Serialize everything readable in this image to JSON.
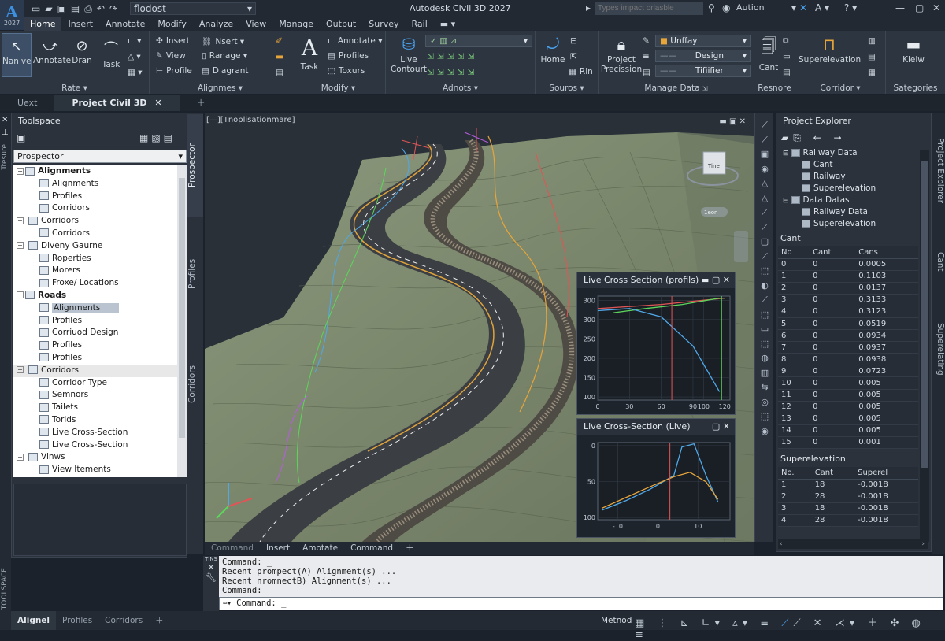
{
  "app": {
    "logo_letter": "A",
    "year": "2027",
    "title": "Autodesk Civil 3D 2027",
    "document": "flodost",
    "search_placeholder": "Types impact orlasble",
    "user": "Aution"
  },
  "menu_tabs": [
    "Home",
    "Insert",
    "Annotate",
    "Modify",
    "Analyze",
    "View",
    "Manage",
    "Output",
    "Survey",
    "Rail"
  ],
  "ribbon": {
    "home_btns": [
      "Nanive",
      "Annotate",
      "Dran",
      "Task"
    ],
    "p1_title": "Rate",
    "p2_rows": [
      "Insert",
      "View",
      "Profile"
    ],
    "p2_rows_b": [
      "Nsert",
      "Ranage",
      "Diagrant"
    ],
    "p2_title": "Alignmes",
    "p3_btn": "Task",
    "p3_rows": [
      "Annotate",
      "Profiles",
      "Toxurs"
    ],
    "p3_title": "Modify",
    "p4_btn": "Live Contourt",
    "p4_title": "Adnots",
    "p5_btn": "Home",
    "p5_row": "Rin",
    "p5_title": "Souros",
    "p6_btn": "Project Precission",
    "p6_selects": [
      "Unffay",
      "Design",
      "Tifiifier"
    ],
    "p6_title": "Manage Data",
    "p7_btn": "Cant",
    "p7_title": "Resnore",
    "p8_btn": "Superelevation",
    "p8_title": "Corridor",
    "p9_btn": "Kleiw",
    "p9_title": "Sategories"
  },
  "doc_tabs": [
    "Uext",
    "Project Civil 3D"
  ],
  "toolspace": {
    "title": "Toolspace",
    "prospector": "Prospector",
    "side_tabs": [
      "Prospector",
      "Profiles",
      "Corridors"
    ],
    "strip_labels": [
      "Tresure",
      "TOOLSPACE"
    ],
    "tree": [
      {
        "label": "Alignments",
        "bold": true,
        "indent": 0,
        "pm": "-"
      },
      {
        "label": "Alignments",
        "indent": 1
      },
      {
        "label": "Profiles",
        "indent": 1
      },
      {
        "label": "Corridors",
        "indent": 1
      },
      {
        "label": "Corridors",
        "indent": 1,
        "pm": "+"
      },
      {
        "label": "Corridors",
        "indent": 1
      },
      {
        "label": "Diveny Gaurne",
        "indent": 1,
        "pm": "+"
      },
      {
        "label": "Roperties",
        "indent": 1
      },
      {
        "label": "Morers",
        "indent": 1
      },
      {
        "label": "Froxe/ Locations",
        "indent": 1
      },
      {
        "label": "Roads",
        "bold": true,
        "indent": 0,
        "pm": "+"
      },
      {
        "label": "Alignments",
        "indent": 1,
        "sel": true
      },
      {
        "label": "Profiles",
        "indent": 1
      },
      {
        "label": "Corriuod Design",
        "indent": 1
      },
      {
        "label": "Profiles",
        "indent": 1
      },
      {
        "label": "Profiles",
        "indent": 1
      },
      {
        "label": "Corridors",
        "indent": 1,
        "pm": "+",
        "hl": true
      },
      {
        "label": "Corridor Type",
        "indent": 1
      },
      {
        "label": "Semnors",
        "indent": 1
      },
      {
        "label": "Tailets",
        "indent": 1
      },
      {
        "label": "Torids",
        "indent": 1
      },
      {
        "label": "Live Cross-Section",
        "indent": 1
      },
      {
        "label": "Live Cross-Section",
        "indent": 1
      },
      {
        "label": "Vinws",
        "indent": 1,
        "pm": "+"
      },
      {
        "label": "View Itements",
        "indent": 1
      }
    ]
  },
  "viewport": {
    "label": "[—][Tnoplisationmare]",
    "viewcube": "Tine",
    "nav": "1eon"
  },
  "chart1": {
    "title": "Live Cross Section (profils)",
    "chart_data": {
      "type": "line",
      "xlim": [
        0,
        125
      ],
      "ylim": [
        90,
        340
      ],
      "xticks": [
        0,
        30,
        60,
        90,
        100,
        120
      ],
      "yticks": [
        100,
        150,
        200,
        250,
        300,
        300
      ],
      "series": [
        {
          "color": "#e05555",
          "x": [
            0,
            60,
            120
          ],
          "y": [
            310,
            320,
            335
          ]
        },
        {
          "color": "#5cd65c",
          "x": [
            15,
            45,
            80,
            115,
            120
          ],
          "y": [
            300,
            310,
            320,
            335,
            335
          ]
        },
        {
          "color": "#4fa8e8",
          "x": [
            0,
            30,
            60,
            90,
            115
          ],
          "y": [
            305,
            310,
            290,
            220,
            110
          ]
        }
      ],
      "vlines": [
        {
          "x": 70,
          "color": "#e05555"
        },
        {
          "x": 117,
          "color": "#5cd65c"
        }
      ]
    }
  },
  "chart2": {
    "title": "Live Cross-Section (Live)",
    "chart_data": {
      "type": "line",
      "xlim": [
        -15,
        18
      ],
      "ylim": [
        -10,
        112
      ],
      "xticks": [
        -10,
        0,
        10
      ],
      "yticks": [
        100,
        50,
        0
      ],
      "series": [
        {
          "color": "#4fa8e8",
          "x": [
            -14,
            -8,
            -2,
            4,
            6,
            9,
            12,
            15
          ],
          "y": [
            5,
            20,
            38,
            60,
            105,
            110,
            60,
            18
          ]
        },
        {
          "color": "#e8a53a",
          "x": [
            -14,
            -8,
            -2,
            4,
            8,
            12,
            15
          ],
          "y": [
            8,
            25,
            42,
            58,
            65,
            50,
            22
          ]
        }
      ],
      "vlines": [
        {
          "x": 3,
          "color": "#e05555"
        }
      ]
    }
  },
  "project_explorer": {
    "title": "Project Explorer",
    "strip_labels": [
      "Project Explorer",
      "Cant",
      "Superelating"
    ],
    "tree": [
      {
        "label": "Railway Data",
        "indent": 0,
        "pm": "-"
      },
      {
        "label": "Cant",
        "indent": 1
      },
      {
        "label": "Railway",
        "indent": 1
      },
      {
        "label": "Superelevation",
        "indent": 1
      },
      {
        "label": "Data Datas",
        "indent": 0,
        "pm": "-"
      },
      {
        "label": "Railway Data",
        "indent": 1
      },
      {
        "label": "Superelevation",
        "indent": 1
      }
    ],
    "cant_title": "Cant",
    "cant_cols": [
      "No",
      "Cant",
      "Cans"
    ],
    "cant_rows": [
      [
        "0",
        "0",
        "0.0005"
      ],
      [
        "1",
        "0",
        "0.1103"
      ],
      [
        "2",
        "0",
        "0.0137"
      ],
      [
        "3",
        "0",
        "0.3133"
      ],
      [
        "4",
        "0",
        "0.3123"
      ],
      [
        "5",
        "0",
        "0.0519"
      ],
      [
        "6",
        "0",
        "0.0934"
      ],
      [
        "7",
        "0",
        "0.0937"
      ],
      [
        "8",
        "0",
        "0.0938"
      ],
      [
        "9",
        "0",
        "0.0723"
      ],
      [
        "10",
        "0",
        "0.005"
      ],
      [
        "11",
        "0",
        "0.005"
      ],
      [
        "12",
        "0",
        "0.005"
      ],
      [
        "13",
        "0",
        "0.005"
      ],
      [
        "14",
        "0",
        "0.005"
      ],
      [
        "15",
        "0",
        "0.001"
      ]
    ],
    "super_title": "Superelevation",
    "super_cols": [
      "No.",
      "Cant",
      "Superel"
    ],
    "super_rows": [
      [
        "1",
        "18",
        "-0.0018"
      ],
      [
        "2",
        "28",
        "-0.0018"
      ],
      [
        "3",
        "18",
        "-0.0018"
      ],
      [
        "4",
        "28",
        "-0.0018"
      ]
    ]
  },
  "command": {
    "tabs": [
      "Command",
      "Insert",
      "Amotate",
      "Command"
    ],
    "side": "TINS",
    "history": [
      "Command: _",
      "Recent prompect(A) Alignment(s) ...",
      "Recent nromnectB) Alignment(s) ...",
      "Command: _"
    ],
    "input": "Command: _"
  },
  "status": {
    "tabs": [
      "Alignel",
      "Profiles",
      "Corridors"
    ],
    "method": "Metnod"
  }
}
